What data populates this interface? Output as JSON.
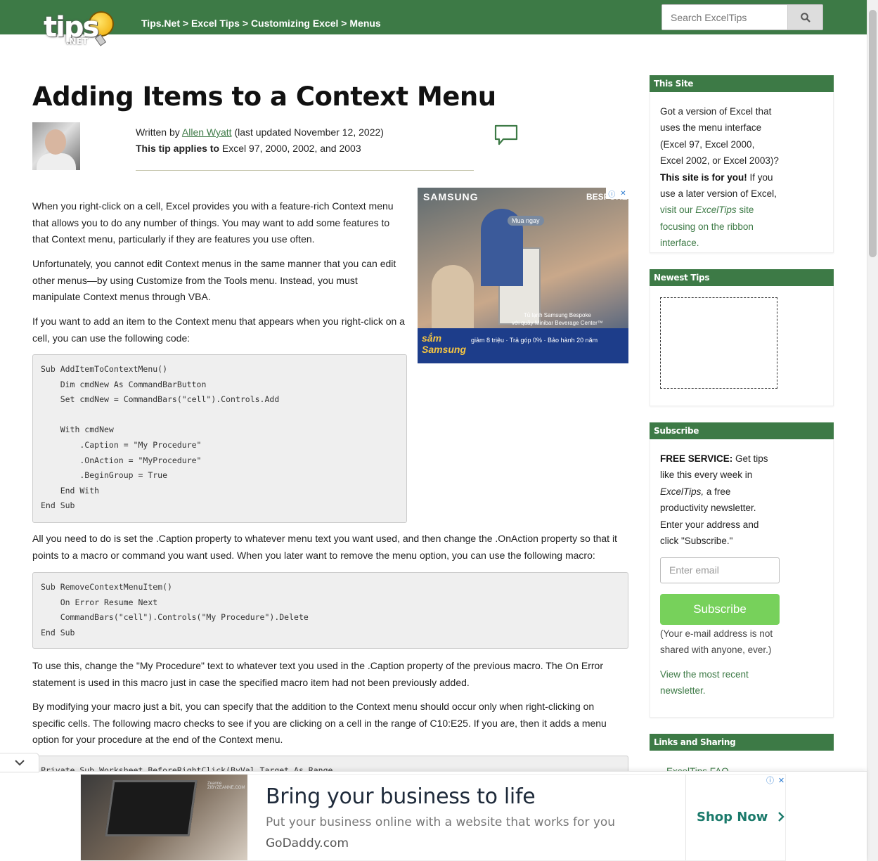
{
  "header": {
    "logo_text": "tips",
    "logo_sub": ".NET",
    "breadcrumb": [
      {
        "label": "Tips.Net"
      },
      {
        "label": "Excel Tips"
      },
      {
        "label": "Customizing Excel"
      },
      {
        "label": "Menus"
      }
    ],
    "breadcrumb_sep": " > ",
    "search_placeholder": "Search ExcelTips"
  },
  "article": {
    "title": "Adding Items to a Context Menu",
    "written_by": "Written by ",
    "author": "Allen Wyatt",
    "updated": " (last updated November 12, 2022)",
    "applies_label": "This tip applies to",
    "applies_value": " Excel 97, 2000, 2002, and 2003",
    "paragraphs": [
      "When you right-click on a cell, Excel provides you with a feature-rich Context menu that allows you to do any number of things. You may want to add some features to that Context menu, particularly if they are features you use often.",
      "Unfortunately, you cannot edit Context menus in the same manner that you can edit other menus—by using Customize from the Tools menu. Instead, you must manipulate Context menus through VBA.",
      "If you want to add an item to the Context menu that appears when you right-click on a cell, you can use the following code:",
      "All you need to do is set the .Caption property to whatever menu text you want used, and then change the .OnAction property so that it points to a macro or command you want used. When you later want to remove the menu option, you can use the following macro:",
      "To use this, change the \"My Procedure\" text to whatever text you used in the .Caption property of the previous macro. The On Error statement is used in this macro just in case the specified macro item had not been previously added.",
      "By modifying your macro just a bit, you can specify that the addition to the Context menu should occur only when right-clicking on specific cells. The following macro checks to see if you are clicking on a cell in the range of C10:E25. If you are, then it adds a menu option for your procedure at the end of the Context menu."
    ],
    "code1": "Sub AddItemToContextMenu()\n    Dim cmdNew As CommandBarButton\n    Set cmdNew = CommandBars(\"cell\").Controls.Add\n\n    With cmdNew\n        .Caption = \"My Procedure\"\n        .OnAction = \"MyProcedure\"\n        .BeginGroup = True\n    End With\nEnd Sub",
    "code2": "Sub RemoveContextMenuItem()\n    On Error Resume Next\n    CommandBars(\"cell\").Controls(\"My Procedure\").Delete\nEnd Sub",
    "code3": "Private Sub Worksheet_BeforeRightClick(ByVal Target As Range,"
  },
  "square_ad": {
    "brand": "SAMSUNG",
    "bespoke": "BESPOKE",
    "pill": "Mua ngay",
    "caption_line1": "Tủ lạnh Samsung Bespoke",
    "caption_line2": "với quầy Minibar Beverage Center™",
    "sam_line1": "sắm",
    "sam_line2": "Samsung",
    "promo": "giảm 8 triệu · Trả góp 0% · Bảo hành 20 năm"
  },
  "sidebar": {
    "this_site": {
      "heading": "This Site",
      "t1": "Got a version of Excel that uses the menu interface (Excel 97, Excel 2000, Excel 2002, or Excel 2003)? ",
      "b1": "This site is for you!",
      "t2": " If you use a later version of Excel, ",
      "link1": "visit our ",
      "link_em": "ExcelTips",
      "link2": " site focusing on the ribbon interface."
    },
    "newest": {
      "heading": "Newest Tips"
    },
    "subscribe": {
      "heading": "Subscribe",
      "b1": "FREE SERVICE:",
      "t1": " Get tips like this every week in ",
      "em1": "ExcelTips,",
      "t2": " a free productivity newsletter. Enter your address and click \"Subscribe.\"",
      "email_placeholder": "Enter email",
      "button": "Subscribe",
      "note": "(Your e-mail address is not shared with anyone, ever.)",
      "view_link": "View the most recent newsletter."
    },
    "links": {
      "heading": "Links and Sharing",
      "first_item": "ExcelTips FAQ"
    }
  },
  "banner_ad": {
    "image_text": "Zeanne ZIBYZEANNE.COM",
    "title": "Bring your business to life",
    "subtitle": "Put your business online with a website that works for you",
    "domain": "GoDaddy.com",
    "cta": "Shop Now"
  },
  "colors": {
    "brand_green": "#3d7a46",
    "subscribe_green": "#77d15b",
    "link_green": "#3d7a46"
  }
}
